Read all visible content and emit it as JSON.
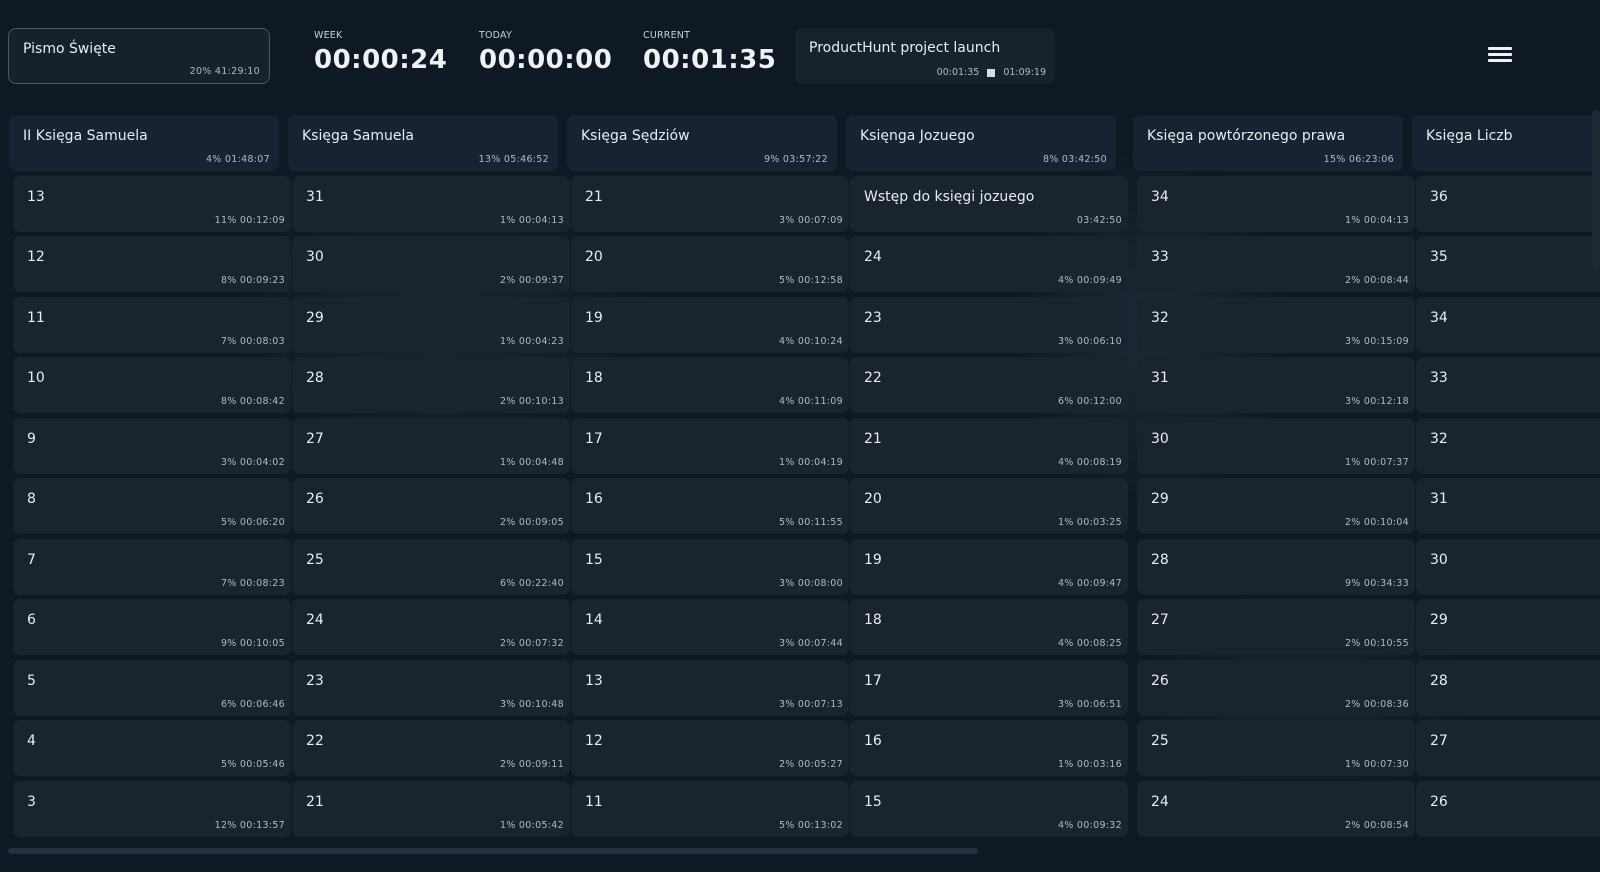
{
  "header": {
    "project": {
      "title": "Pismo Święte",
      "meta": "20% 41:29:10"
    },
    "stats": [
      {
        "label": "WEEK",
        "value": "00:00:24"
      },
      {
        "label": "TODAY",
        "value": "00:00:00"
      },
      {
        "label": "CURRENT",
        "value": "00:01:35"
      }
    ],
    "task": {
      "title": "ProductHunt project launch",
      "elapsed": "00:01:35",
      "total": "01:09:19",
      "stop_icon": "stop-icon"
    },
    "menu_icon": "hamburger-menu-icon"
  },
  "columns": [
    {
      "title": "II Księga Samuela",
      "meta": "4% 01:48:07",
      "items": [
        {
          "title": "13",
          "meta": "11% 00:12:09"
        },
        {
          "title": "12",
          "meta": "8% 00:09:23"
        },
        {
          "title": "11",
          "meta": "7% 00:08:03"
        },
        {
          "title": "10",
          "meta": "8% 00:08:42"
        },
        {
          "title": "9",
          "meta": "3% 00:04:02"
        },
        {
          "title": "8",
          "meta": "5% 00:06:20"
        },
        {
          "title": "7",
          "meta": "7% 00:08:23"
        },
        {
          "title": "6",
          "meta": "9% 00:10:05"
        },
        {
          "title": "5",
          "meta": "6% 00:06:46"
        },
        {
          "title": "4",
          "meta": "5% 00:05:46"
        },
        {
          "title": "3",
          "meta": "12% 00:13:57"
        }
      ]
    },
    {
      "title": "Księga Samuela",
      "meta": "13% 05:46:52",
      "items": [
        {
          "title": "31",
          "meta": "1% 00:04:13"
        },
        {
          "title": "30",
          "meta": "2% 00:09:37"
        },
        {
          "title": "29",
          "meta": "1% 00:04:23"
        },
        {
          "title": "28",
          "meta": "2% 00:10:13"
        },
        {
          "title": "27",
          "meta": "1% 00:04:48"
        },
        {
          "title": "26",
          "meta": "2% 00:09:05"
        },
        {
          "title": "25",
          "meta": "6% 00:22:40"
        },
        {
          "title": "24",
          "meta": "2% 00:07:32"
        },
        {
          "title": "23",
          "meta": "3% 00:10:48"
        },
        {
          "title": "22",
          "meta": "2% 00:09:11"
        },
        {
          "title": "21",
          "meta": "1% 00:05:42"
        }
      ]
    },
    {
      "title": "Księga Sędziów",
      "meta": "9% 03:57:22",
      "items": [
        {
          "title": "21",
          "meta": "3% 00:07:09"
        },
        {
          "title": "20",
          "meta": "5% 00:12:58"
        },
        {
          "title": "19",
          "meta": "4% 00:10:24"
        },
        {
          "title": "18",
          "meta": "4% 00:11:09"
        },
        {
          "title": "17",
          "meta": "1% 00:04:19"
        },
        {
          "title": "16",
          "meta": "5% 00:11:55"
        },
        {
          "title": "15",
          "meta": "3% 00:08:00"
        },
        {
          "title": "14",
          "meta": "3% 00:07:44"
        },
        {
          "title": "13",
          "meta": "3% 00:07:13"
        },
        {
          "title": "12",
          "meta": "2% 00:05:27"
        },
        {
          "title": "11",
          "meta": "5% 00:13:02"
        }
      ]
    },
    {
      "title": "Księnga Jozuego",
      "meta": "8% 03:42:50",
      "items": [
        {
          "title": "Wstęp do księgi jozuego",
          "meta": "03:42:50"
        },
        {
          "title": "24",
          "meta": "4% 00:09:49"
        },
        {
          "title": "23",
          "meta": "3% 00:06:10"
        },
        {
          "title": "22",
          "meta": "6% 00:12:00"
        },
        {
          "title": "21",
          "meta": "4% 00:08:19"
        },
        {
          "title": "20",
          "meta": "1% 00:03:25"
        },
        {
          "title": "19",
          "meta": "4% 00:09:47"
        },
        {
          "title": "18",
          "meta": "4% 00:08:25"
        },
        {
          "title": "17",
          "meta": "3% 00:06:51"
        },
        {
          "title": "16",
          "meta": "1% 00:03:16"
        },
        {
          "title": "15",
          "meta": "4% 00:09:32"
        }
      ]
    },
    {
      "title": "Księga powtórzonego prawa",
      "meta": "15% 06:23:06",
      "items": [
        {
          "title": "34",
          "meta": "1% 00:04:13"
        },
        {
          "title": "33",
          "meta": "2% 00:08:44"
        },
        {
          "title": "32",
          "meta": "3% 00:15:09"
        },
        {
          "title": "31",
          "meta": "3% 00:12:18"
        },
        {
          "title": "30",
          "meta": "1% 00:07:37"
        },
        {
          "title": "29",
          "meta": "2% 00:10:04"
        },
        {
          "title": "28",
          "meta": "9% 00:34:33"
        },
        {
          "title": "27",
          "meta": "2% 00:10:55"
        },
        {
          "title": "26",
          "meta": "2% 00:08:36"
        },
        {
          "title": "25",
          "meta": "1% 00:07:30"
        },
        {
          "title": "24",
          "meta": "2% 00:08:54"
        }
      ]
    },
    {
      "title": "Księga Liczb",
      "meta": "",
      "items": [
        {
          "title": "36",
          "meta": ""
        },
        {
          "title": "35",
          "meta": ""
        },
        {
          "title": "34",
          "meta": ""
        },
        {
          "title": "33",
          "meta": ""
        },
        {
          "title": "32",
          "meta": ""
        },
        {
          "title": "31",
          "meta": ""
        },
        {
          "title": "30",
          "meta": ""
        },
        {
          "title": "29",
          "meta": ""
        },
        {
          "title": "28",
          "meta": ""
        },
        {
          "title": "27",
          "meta": ""
        },
        {
          "title": "26",
          "meta": ""
        }
      ]
    }
  ]
}
